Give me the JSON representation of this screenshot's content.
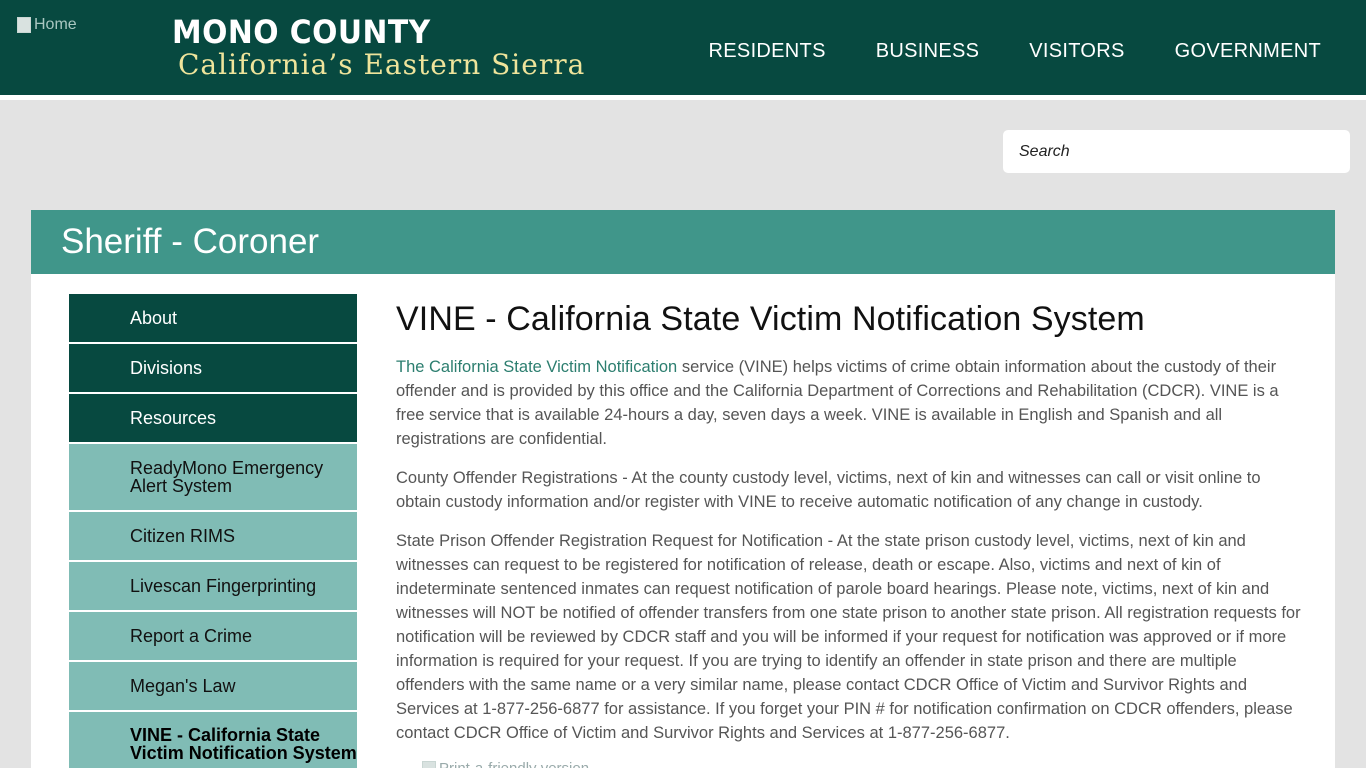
{
  "header": {
    "logo_alt": "Home",
    "brand_line1": "MONO COUNTY",
    "brand_line2": "California’s Eastern Sierra",
    "nav": [
      "RESIDENTS",
      "BUSINESS",
      "VISITORS",
      "GOVERNMENT"
    ]
  },
  "search": {
    "placeholder": "Search"
  },
  "banner": {
    "title": "Sheriff - Coroner"
  },
  "sidenav": {
    "items": [
      {
        "label": "About"
      },
      {
        "label": "Divisions"
      },
      {
        "label": "Resources"
      },
      {
        "label": "ReadyMono Emergency Alert System"
      },
      {
        "label": "Citizen RIMS"
      },
      {
        "label": "Livescan Fingerprinting"
      },
      {
        "label": "Report a Crime"
      },
      {
        "label": "Megan's Law"
      },
      {
        "label": "VINE - California State Victim Notification System"
      }
    ]
  },
  "main": {
    "title": "VINE - California State Victim Notification System",
    "p1_link": "The California State Victim Notification",
    "p1_rest": " service (VINE) helps victims of crime obtain information about the custody of their offender and is provided by this office and the California Department of Corrections and Rehabilitation (CDCR). VINE is a free service that is available 24-hours a day, seven days a week. VINE is available in English and Spanish and all registrations are confidential.",
    "p2": "County Offender Registrations - At the county custody level, victims, next of kin and witnesses can call or visit online to obtain custody information and/or register with VINE to receive automatic notification of any change in custody.",
    "p3": "State Prison Offender Registration Request for Notification - At the state prison custody level, victims, next of kin and witnesses can request to be registered for notification of release, death or escape. Also, victims and next of kin of indeterminate sentenced inmates can request notification of parole board hearings. Please note, victims, next of kin and witnesses will NOT be notified of offender transfers from one state prison to another state prison. All registration requests for notification will be reviewed by CDCR staff and you will be informed if your request for notification was approved or if more information is required for your request. If you are trying to identify an offender in state prison and there are multiple offenders with the same name or a very similar name, please contact CDCR Office of Victim and Survivor Rights and Services at 1-877-256-6877 for assistance. If you forget your PIN # for notification confirmation on CDCR offenders, please contact CDCR Office of Victim and Survivor Rights and Services at 1-877-256-6877.",
    "image_alt": "Print-a-friendly version"
  }
}
